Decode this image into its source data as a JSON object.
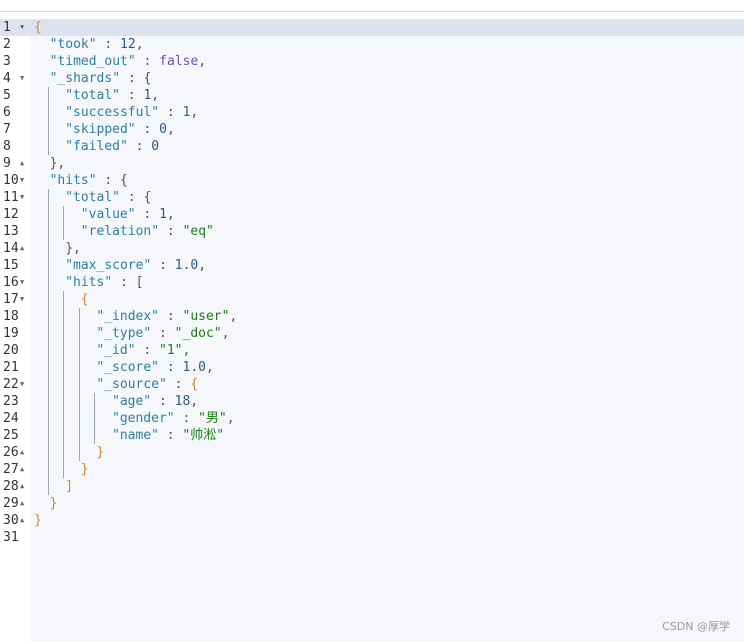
{
  "colors": {
    "key": "#2e7fa5",
    "string": "#1a7f1a",
    "number": "#2b5a8a",
    "boolean": "#6b4fbf",
    "active_line": "#dde3ec",
    "editor_bg": "#f5f7fa"
  },
  "lines": [
    {
      "n": "1",
      "fold": "open",
      "indent": 0,
      "tokens": [
        [
          "brace",
          "{"
        ]
      ]
    },
    {
      "n": "2",
      "indent": 2,
      "tokens": [
        [
          "key",
          "\"took\""
        ],
        [
          "punc",
          " : "
        ],
        [
          "num",
          "12"
        ],
        [
          "punc",
          ","
        ]
      ]
    },
    {
      "n": "3",
      "indent": 2,
      "tokens": [
        [
          "key",
          "\"timed_out\""
        ],
        [
          "punc",
          " : "
        ],
        [
          "bool",
          "false"
        ],
        [
          "punc",
          ","
        ]
      ]
    },
    {
      "n": "4",
      "fold": "open",
      "indent": 2,
      "tokens": [
        [
          "key",
          "\"_shards\""
        ],
        [
          "punc",
          " : "
        ],
        [
          "punc",
          "{"
        ]
      ]
    },
    {
      "n": "5",
      "indent": 4,
      "tokens": [
        [
          "key",
          "\"total\""
        ],
        [
          "punc",
          " : "
        ],
        [
          "num",
          "1"
        ],
        [
          "punc",
          ","
        ]
      ]
    },
    {
      "n": "6",
      "indent": 4,
      "tokens": [
        [
          "key",
          "\"successful\""
        ],
        [
          "punc",
          " : "
        ],
        [
          "num",
          "1"
        ],
        [
          "punc",
          ","
        ]
      ]
    },
    {
      "n": "7",
      "indent": 4,
      "tokens": [
        [
          "key",
          "\"skipped\""
        ],
        [
          "punc",
          " : "
        ],
        [
          "num",
          "0"
        ],
        [
          "punc",
          ","
        ]
      ]
    },
    {
      "n": "8",
      "indent": 4,
      "tokens": [
        [
          "key",
          "\"failed\""
        ],
        [
          "punc",
          " : "
        ],
        [
          "num",
          "0"
        ]
      ]
    },
    {
      "n": "9",
      "fold": "close",
      "indent": 2,
      "tokens": [
        [
          "punc",
          "},"
        ]
      ]
    },
    {
      "n": "10",
      "fold": "open",
      "indent": 2,
      "tokens": [
        [
          "key",
          "\"hits\""
        ],
        [
          "punc",
          " : "
        ],
        [
          "punc",
          "{"
        ]
      ]
    },
    {
      "n": "11",
      "fold": "open",
      "indent": 4,
      "tokens": [
        [
          "key",
          "\"total\""
        ],
        [
          "punc",
          " : "
        ],
        [
          "punc",
          "{"
        ]
      ]
    },
    {
      "n": "12",
      "indent": 6,
      "tokens": [
        [
          "key",
          "\"value\""
        ],
        [
          "punc",
          " : "
        ],
        [
          "num",
          "1"
        ],
        [
          "punc",
          ","
        ]
      ]
    },
    {
      "n": "13",
      "indent": 6,
      "tokens": [
        [
          "key",
          "\"relation\""
        ],
        [
          "punc",
          " : "
        ],
        [
          "str",
          "\"eq\""
        ]
      ]
    },
    {
      "n": "14",
      "fold": "close",
      "indent": 4,
      "tokens": [
        [
          "punc",
          "},"
        ]
      ]
    },
    {
      "n": "15",
      "indent": 4,
      "tokens": [
        [
          "key",
          "\"max_score\""
        ],
        [
          "punc",
          " : "
        ],
        [
          "num",
          "1.0"
        ],
        [
          "punc",
          ","
        ]
      ]
    },
    {
      "n": "16",
      "fold": "open",
      "indent": 4,
      "tokens": [
        [
          "key",
          "\"hits\""
        ],
        [
          "punc",
          " : "
        ],
        [
          "punc",
          "["
        ]
      ]
    },
    {
      "n": "17",
      "fold": "open",
      "indent": 6,
      "tokens": [
        [
          "brace",
          "{"
        ]
      ]
    },
    {
      "n": "18",
      "indent": 8,
      "tokens": [
        [
          "key",
          "\"_index\""
        ],
        [
          "punc",
          " : "
        ],
        [
          "str",
          "\"user\""
        ],
        [
          "punc",
          ","
        ]
      ]
    },
    {
      "n": "19",
      "indent": 8,
      "tokens": [
        [
          "key",
          "\"_type\""
        ],
        [
          "punc",
          " : "
        ],
        [
          "str",
          "\"_doc\""
        ],
        [
          "punc",
          ","
        ]
      ]
    },
    {
      "n": "20",
      "indent": 8,
      "tokens": [
        [
          "key",
          "\"_id\""
        ],
        [
          "punc",
          " : "
        ],
        [
          "str",
          "\"1\""
        ],
        [
          "punc",
          ","
        ]
      ]
    },
    {
      "n": "21",
      "indent": 8,
      "tokens": [
        [
          "key",
          "\"_score\""
        ],
        [
          "punc",
          " : "
        ],
        [
          "num",
          "1.0"
        ],
        [
          "punc",
          ","
        ]
      ]
    },
    {
      "n": "22",
      "fold": "open",
      "indent": 8,
      "tokens": [
        [
          "key",
          "\"_source\""
        ],
        [
          "punc",
          " : "
        ],
        [
          "brace",
          "{"
        ]
      ]
    },
    {
      "n": "23",
      "indent": 10,
      "tokens": [
        [
          "key",
          "\"age\""
        ],
        [
          "punc",
          " : "
        ],
        [
          "num",
          "18"
        ],
        [
          "punc",
          ","
        ]
      ]
    },
    {
      "n": "24",
      "indent": 10,
      "tokens": [
        [
          "key",
          "\"gender\""
        ],
        [
          "punc",
          " : "
        ],
        [
          "str",
          "\"男\""
        ],
        [
          "punc",
          ","
        ]
      ]
    },
    {
      "n": "25",
      "indent": 10,
      "tokens": [
        [
          "key",
          "\"name\""
        ],
        [
          "punc",
          " : "
        ],
        [
          "str",
          "\"帅淞\""
        ]
      ]
    },
    {
      "n": "26",
      "fold": "close",
      "indent": 8,
      "tokens": [
        [
          "brace",
          "}"
        ]
      ]
    },
    {
      "n": "27",
      "fold": "close",
      "indent": 6,
      "tokens": [
        [
          "brace",
          "}"
        ]
      ]
    },
    {
      "n": "28",
      "fold": "close",
      "indent": 4,
      "tokens": [
        [
          "brace",
          "]"
        ]
      ]
    },
    {
      "n": "29",
      "fold": "close",
      "indent": 2,
      "tokens": [
        [
          "brace",
          "}"
        ]
      ]
    },
    {
      "n": "30",
      "fold": "close",
      "indent": 0,
      "tokens": [
        [
          "brace",
          "}"
        ]
      ]
    },
    {
      "n": "31",
      "indent": 0,
      "tokens": []
    }
  ],
  "watermark": "CSDN @厚学"
}
